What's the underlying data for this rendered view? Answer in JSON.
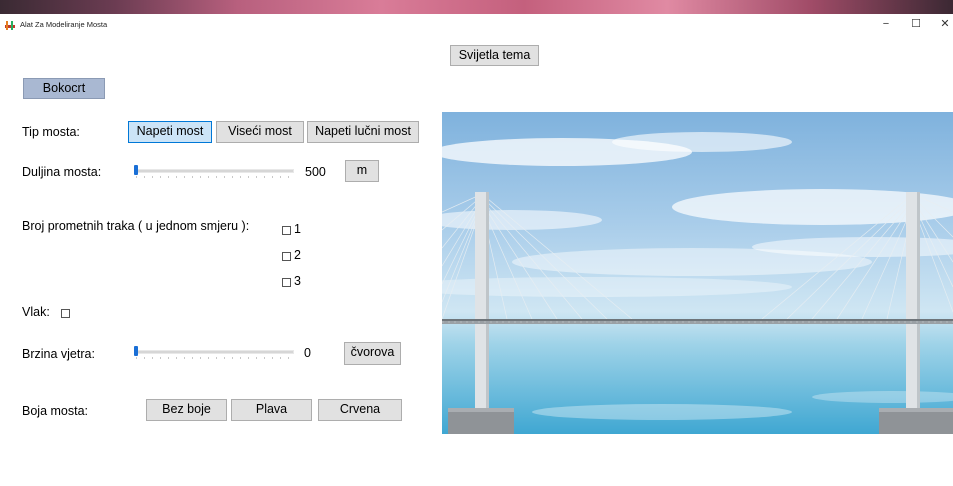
{
  "window": {
    "title": "Alat Za Modeliranje Mosta",
    "minimize": "−",
    "maximize": "☐",
    "close": "✕"
  },
  "buttons": {
    "theme": "Svijetla tema",
    "side_view": "Bokocrt"
  },
  "bridge_type": {
    "label": "Tip mosta:",
    "options": [
      "Napeti most",
      "Viseći most",
      "Napeti lučni most"
    ],
    "selected": "Napeti most"
  },
  "length": {
    "label": "Duljina mosta:",
    "value": "500",
    "unit": "m",
    "slider_fraction": 0.0
  },
  "lanes": {
    "label": "Broj prometnih traka ( u jednom smjeru ):",
    "options": [
      "1",
      "2",
      "3"
    ]
  },
  "train": {
    "label": "Vlak:"
  },
  "wind": {
    "label": "Brzina vjetra:",
    "value": "0",
    "unit": "čvorova",
    "slider_fraction": 0.0
  },
  "color": {
    "label": "Boja mosta:",
    "options": [
      "Bez boje",
      "Plava",
      "Crvena"
    ]
  },
  "colors": {
    "accent": "#0078d7",
    "slider_thumb": "#1a6fd6",
    "side_view_button": "#a9b8d2"
  }
}
